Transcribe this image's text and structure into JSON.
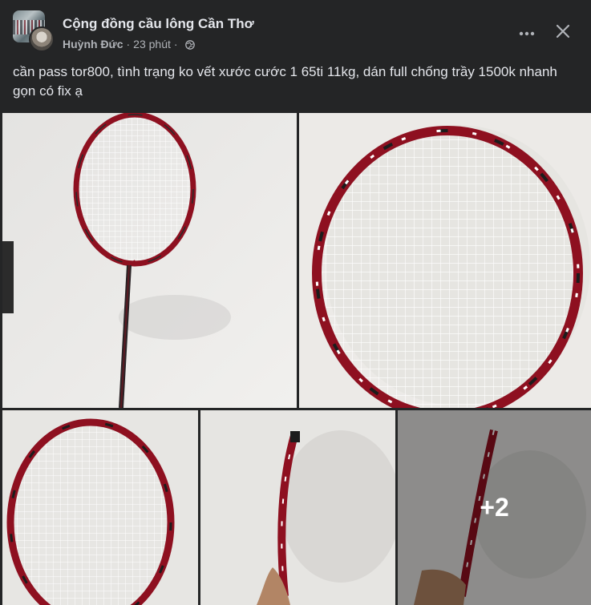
{
  "header": {
    "group_name": "Cộng đồng cầu lông Cần Thơ",
    "author": "Huỳnh Đức",
    "separator": "·",
    "time": "23 phút",
    "privacy_icon": "globe-icon",
    "more_icon": "more-horizontal-icon",
    "close_icon": "close-icon"
  },
  "post": {
    "text": "cần pass tor800, tình trạng ko vết xước cước 1 65ti 11kg, dán full chống trầy 1500k nhanh gọn có fix ạ"
  },
  "photos": {
    "more_count": "+2"
  },
  "colors": {
    "background": "#242526",
    "text_primary": "#e4e6eb",
    "text_secondary": "#b0b3b8",
    "racket_red": "#8e1020"
  }
}
